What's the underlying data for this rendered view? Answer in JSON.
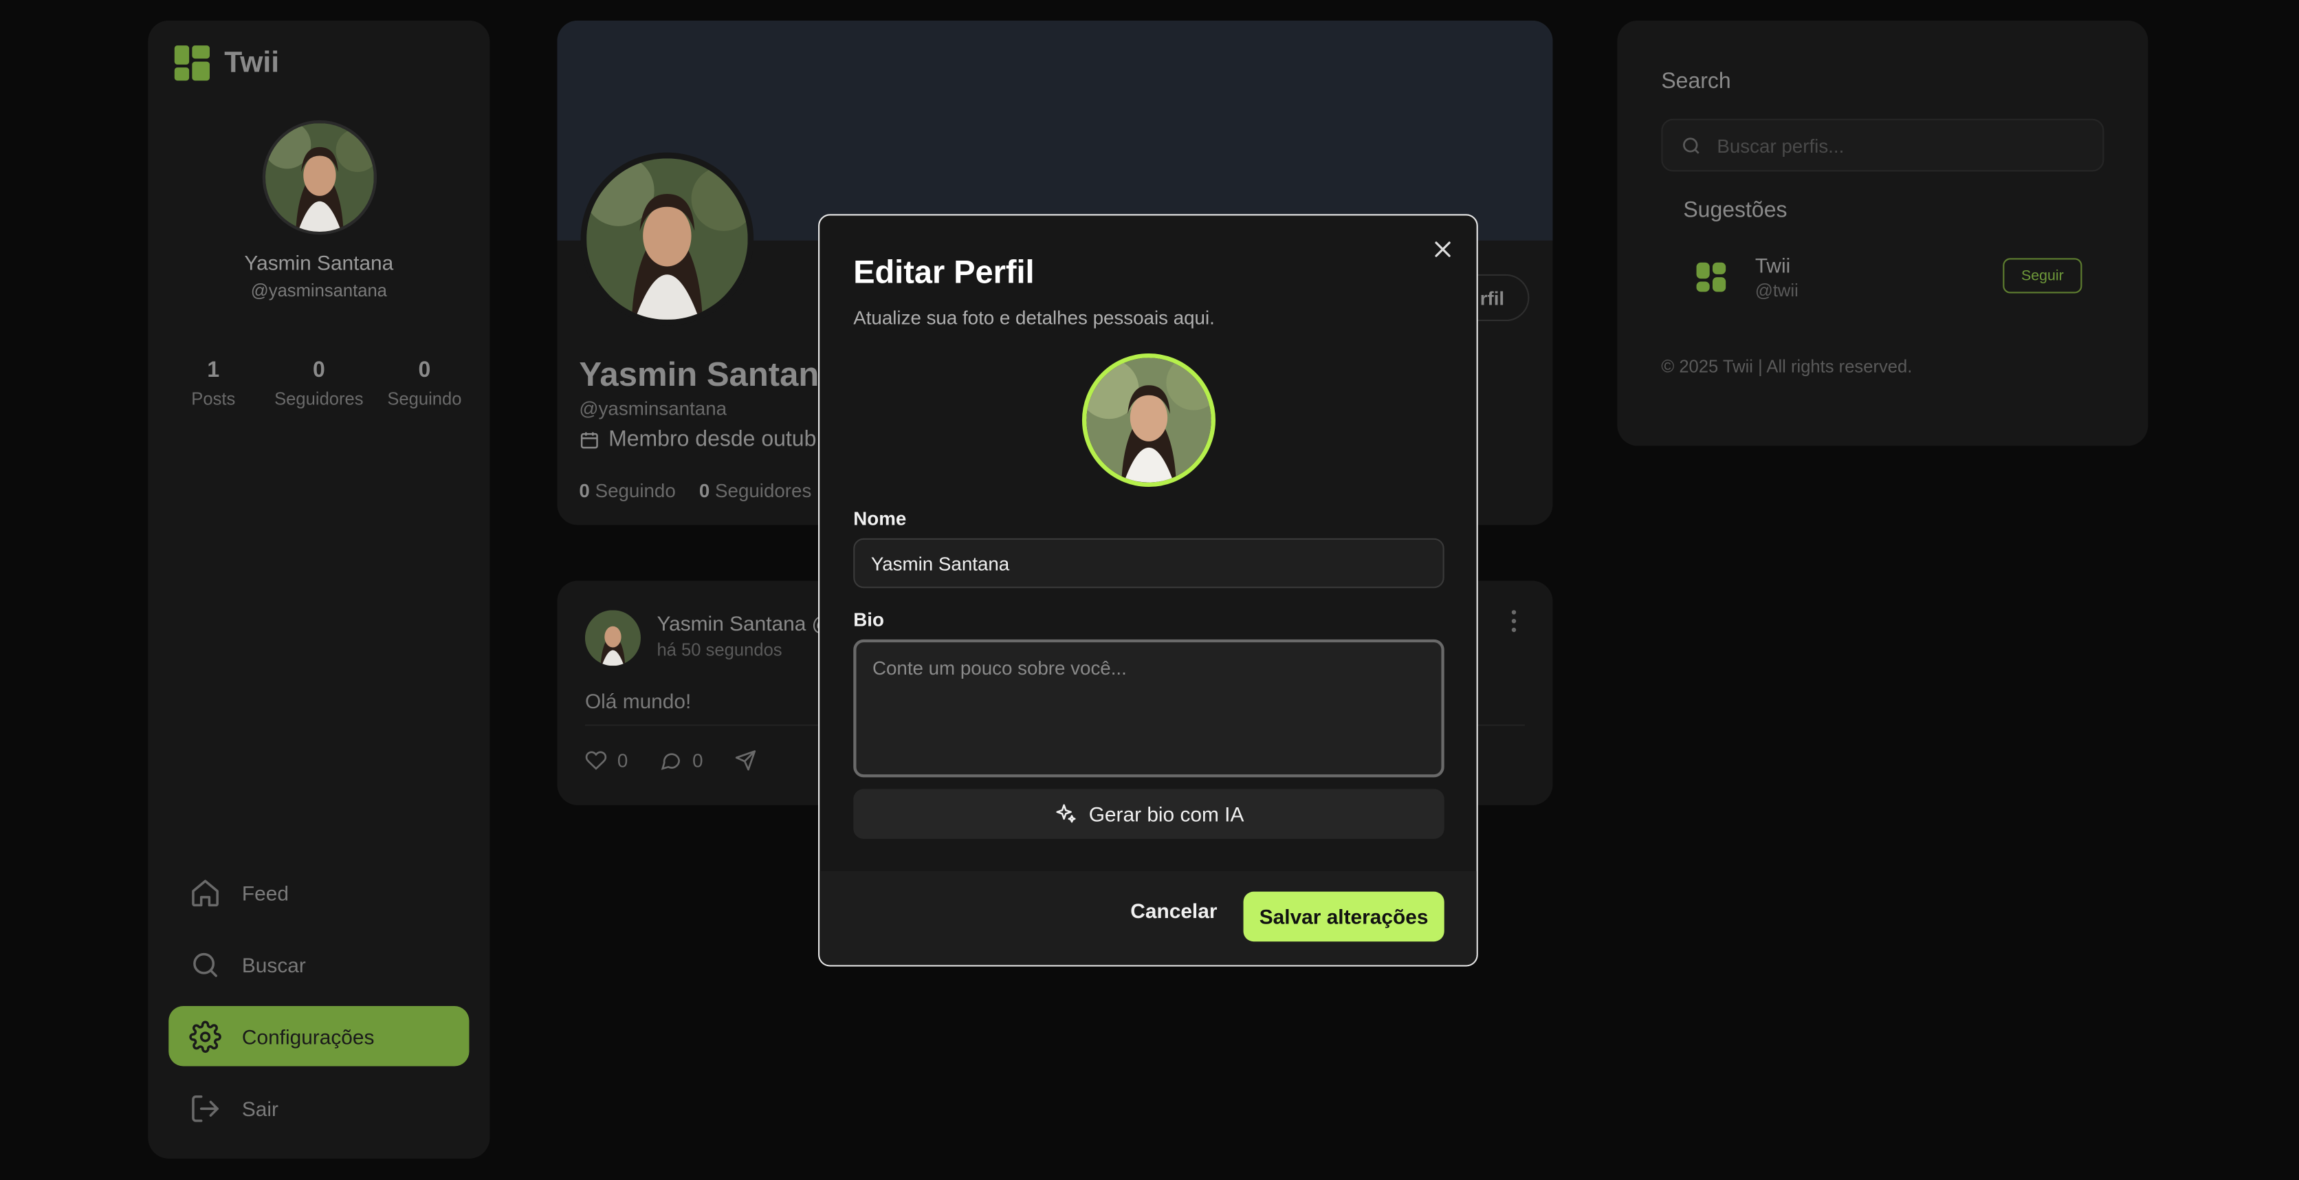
{
  "app": {
    "name": "Twii"
  },
  "user": {
    "name": "Yasmin Santana",
    "handle": "@yasminsantana",
    "stats": [
      {
        "value": "1",
        "label": "Posts"
      },
      {
        "value": "0",
        "label": "Seguidores"
      },
      {
        "value": "0",
        "label": "Seguindo"
      }
    ]
  },
  "nav": {
    "items": [
      {
        "label": "Feed",
        "icon": "home-icon",
        "active": false
      },
      {
        "label": "Buscar",
        "icon": "search-icon",
        "active": false
      },
      {
        "label": "Configurações",
        "icon": "gear-icon",
        "active": true
      },
      {
        "label": "Sair",
        "icon": "logout-icon",
        "active": false
      }
    ]
  },
  "profile": {
    "name": "Yasmin Santana",
    "handle": "@yasminsantana",
    "since": "Membro desde outub",
    "edit_label": "rfil",
    "following_count": "0",
    "following_label": "Seguindo",
    "followers_count": "0",
    "followers_label": "Seguidores"
  },
  "post": {
    "author": "Yasmin Santana @",
    "time": "há 50 segundos",
    "text": "Olá mundo!",
    "likes": "0",
    "comments": "0"
  },
  "right": {
    "search_title": "Search",
    "search_placeholder": "Buscar perfis...",
    "suggestions_title": "Sugestões",
    "suggestion": {
      "name": "Twii",
      "handle": "@twii",
      "follow_label": "Seguir"
    },
    "copyright": "© 2025 Twii | All rights reserved."
  },
  "modal": {
    "title": "Editar Perfil",
    "subtitle": "Atualize sua foto e detalhes pessoais aqui.",
    "name_label": "Nome",
    "name_value": "Yasmin Santana",
    "bio_label": "Bio",
    "bio_placeholder": "Conte um pouco sobre você...",
    "ai_label": "Gerar bio com IA",
    "cancel_label": "Cancelar",
    "save_label": "Salvar alterações"
  },
  "colors": {
    "accent": "#bef264",
    "sidebar_active": "#6f9a3a",
    "background": "#0a0a0a",
    "card": "#171717"
  }
}
